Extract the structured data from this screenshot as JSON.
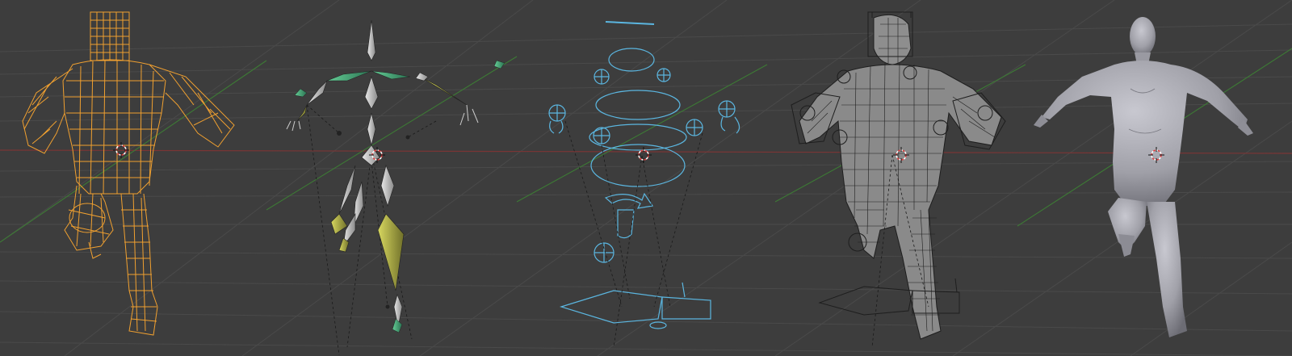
{
  "viewport": {
    "background": "#3d3d3d",
    "grid_color": "#4a4a4a",
    "x_axis_color": "#7a3535",
    "y_axis_color": "#3d7a35"
  },
  "panels": [
    {
      "id": "wireframe-mesh",
      "mode": "wireframe",
      "color": "#f0a030",
      "selected": true
    },
    {
      "id": "armature-bones",
      "mode": "octahedral-bones",
      "bone_color": "#c8c8c8",
      "selected_bone_color": "#b8b84a",
      "ik_bone_color": "#3aa870"
    },
    {
      "id": "control-rig",
      "mode": "custom-shapes",
      "color": "#5bb6e0"
    },
    {
      "id": "mesh-with-rig",
      "mode": "solid-wireframe-overlay",
      "color": "#8a8a8a",
      "wire_color": "#1e1e1e"
    },
    {
      "id": "shaded-mesh",
      "mode": "solid",
      "color": "#a5a5ad"
    }
  ],
  "icons": {
    "cursor": "3d-cursor-icon"
  }
}
